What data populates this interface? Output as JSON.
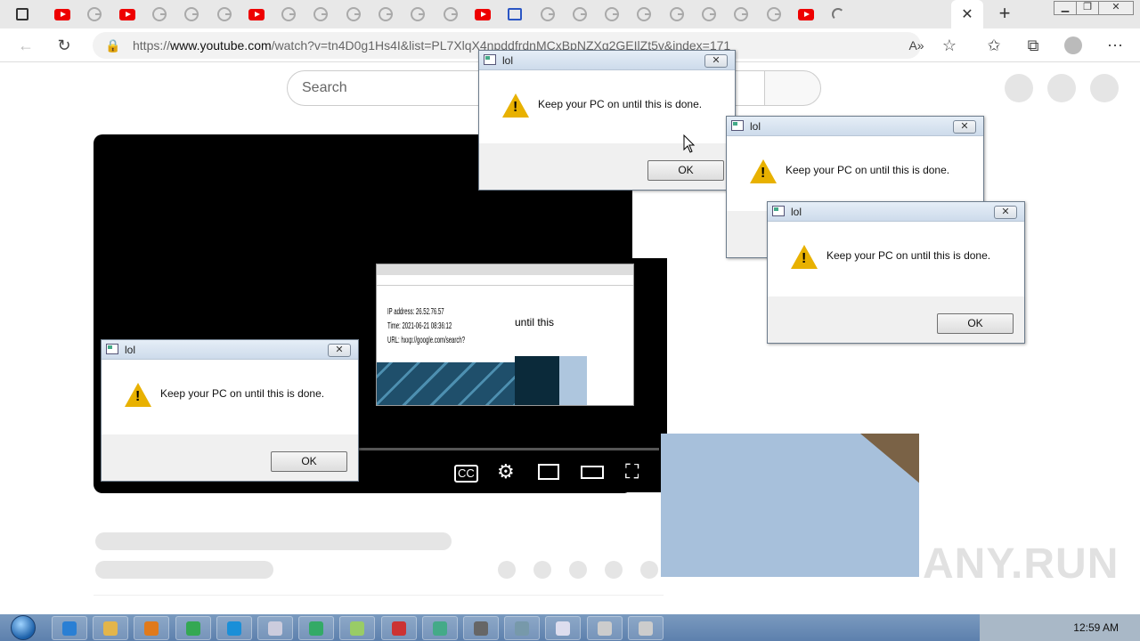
{
  "browser": {
    "url_prefix": "https://",
    "url_host": "www.youtube.com",
    "url_path": "/watch?v=tn4D0g1Hs4I&list=PL7XlqX4npddfrdnMCxBpNZXg2GEIlZt5y&index=171",
    "tab_count_label": "",
    "tabs": [
      "yt",
      "g",
      "yt",
      "g",
      "g",
      "g",
      "yt",
      "g",
      "g",
      "g",
      "g",
      "g",
      "g",
      "yt",
      "ms",
      "g",
      "g",
      "g",
      "g",
      "g",
      "g",
      "g",
      "g",
      "yt",
      "load"
    ]
  },
  "page": {
    "search_placeholder": "Search"
  },
  "dialogs": [
    {
      "title": "lol",
      "message": "Keep your PC on until this is done.",
      "ok": "OK",
      "close": "✕"
    },
    {
      "title": "lol",
      "message": "Keep your PC on until this is done.",
      "ok": "OK",
      "close": "✕"
    },
    {
      "title": "lol",
      "message": "Keep your PC on until this is done.",
      "ok": "OK",
      "close": "✕"
    },
    {
      "title": "lol",
      "message": "Keep your PC on until this is done.",
      "ok": "OK",
      "close": "✕"
    }
  ],
  "ghost": {
    "line1": "IP address: 26.52.76.57",
    "line2": "Time: 2021-06-21 08:36:12",
    "line3": "URL: hxxp://google.com/search?",
    "until_text": "until this"
  },
  "taskbar": {
    "clock": "12:59 AM"
  },
  "watermark": "ANY.RUN",
  "colors": {
    "yt_red": "#ee0000",
    "warning": "#e8b100",
    "taskbar": "#5d80ad"
  }
}
